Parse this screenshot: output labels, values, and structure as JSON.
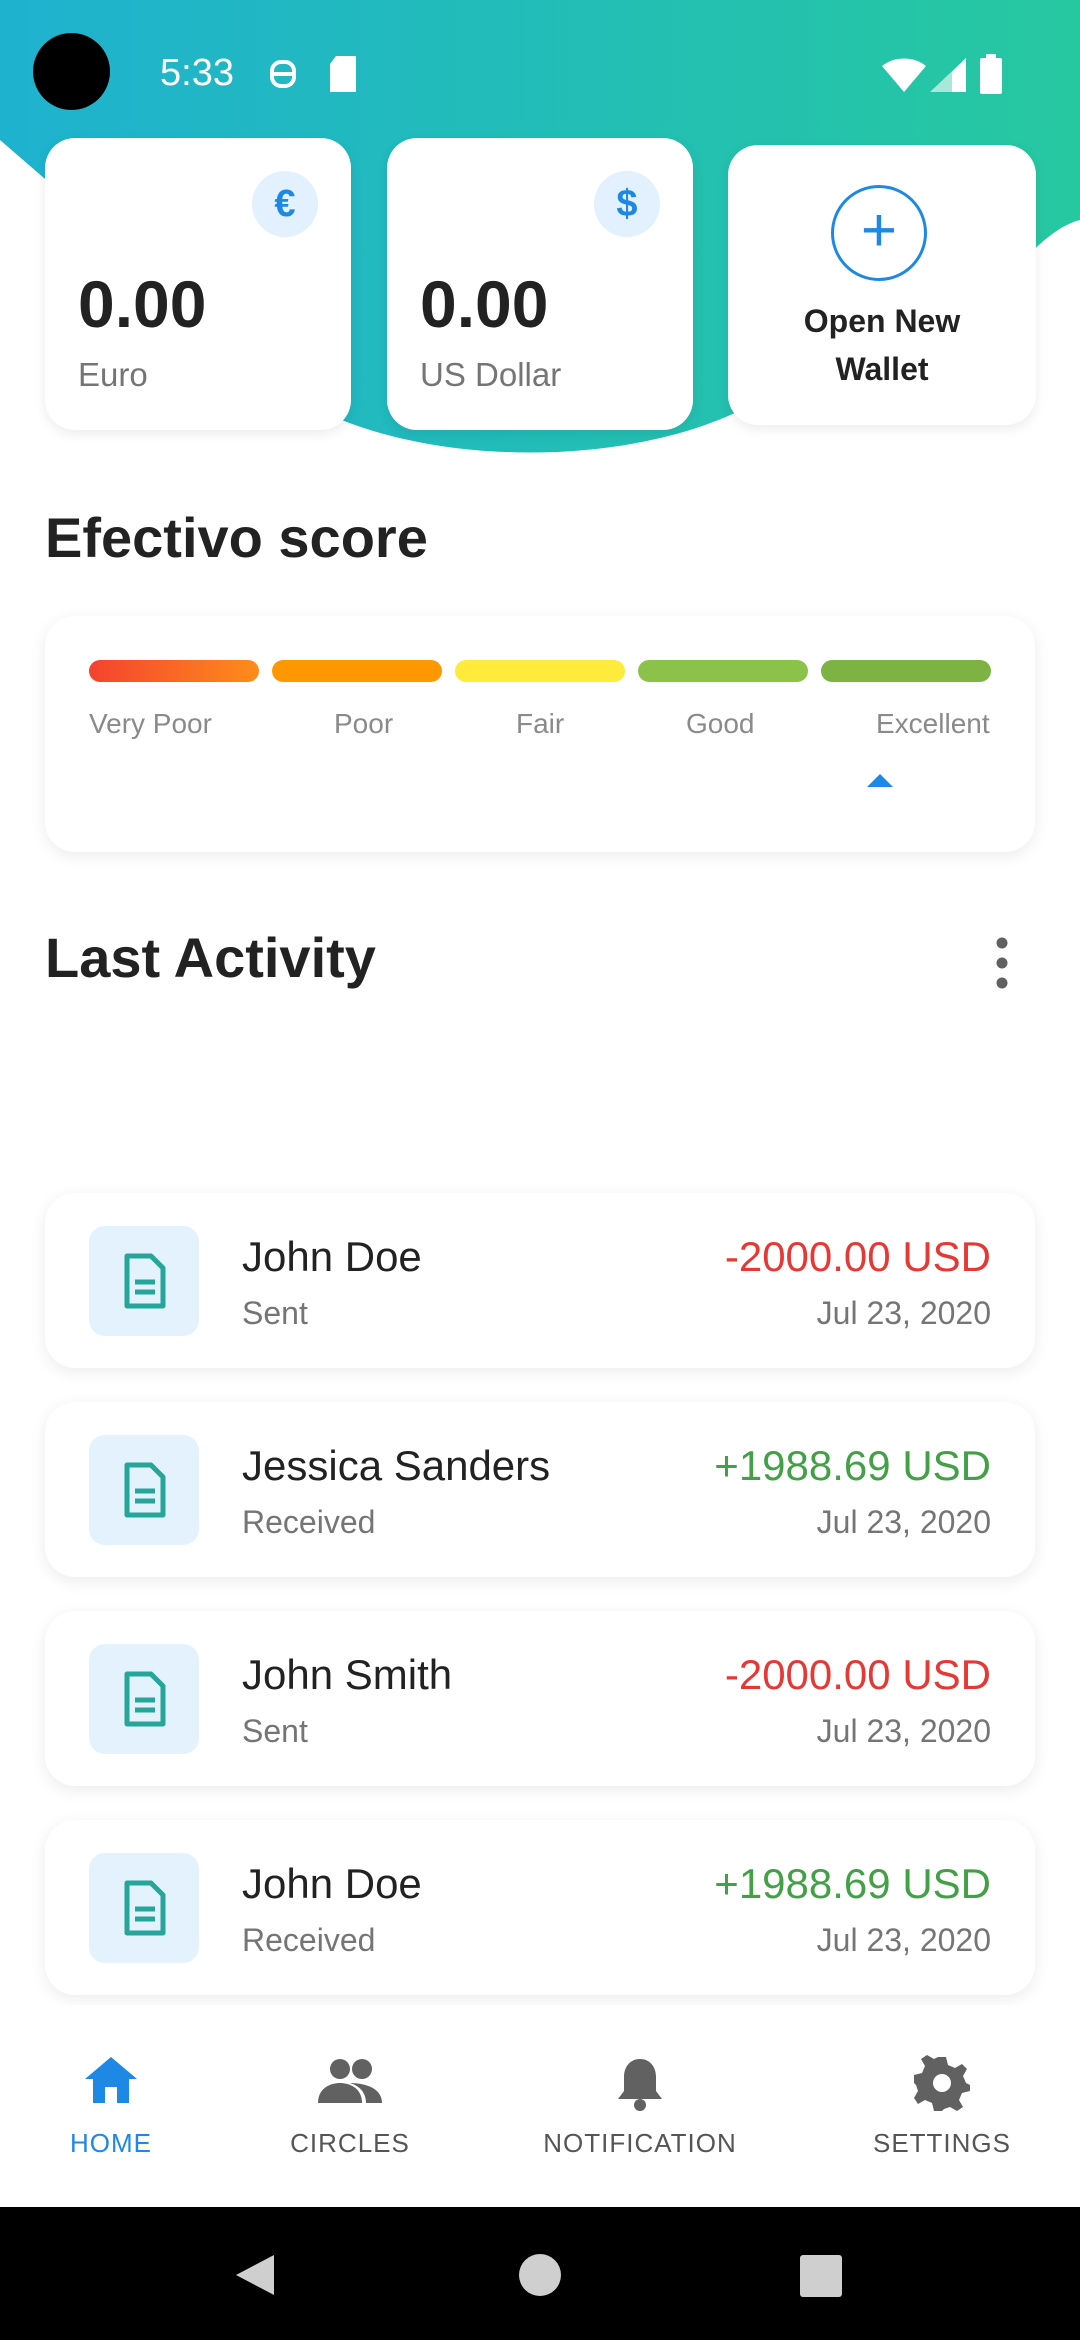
{
  "status_bar": {
    "time": "5:33"
  },
  "wallets": [
    {
      "amount": "0.00",
      "currency": "Euro",
      "symbol": "€"
    },
    {
      "amount": "0.00",
      "currency": "US Dollar",
      "symbol": "$"
    }
  ],
  "open_wallet": {
    "line1": "Open New",
    "line2": "Wallet"
  },
  "score": {
    "title": "Efectivo score",
    "levels": [
      {
        "label": "Very Poor",
        "color": "#f4511e"
      },
      {
        "label": "Poor",
        "color": "#ff9800"
      },
      {
        "label": "Fair",
        "color": "#ffeb3b"
      },
      {
        "label": "Good",
        "color": "#8bc34a"
      },
      {
        "label": "Excellent",
        "color": "#7cb342"
      }
    ],
    "current_level": "Excellent"
  },
  "activity": {
    "title": "Last Activity",
    "items": [
      {
        "name": "John Doe",
        "type": "Sent",
        "amount": "-2000.00 USD",
        "date": "Jul 23, 2020",
        "direction": "out"
      },
      {
        "name": "Jessica Sanders",
        "type": "Received",
        "amount": "+1988.69 USD",
        "date": "Jul 23, 2020",
        "direction": "in"
      },
      {
        "name": "John Smith",
        "type": "Sent",
        "amount": "-2000.00 USD",
        "date": "Jul 23, 2020",
        "direction": "out"
      },
      {
        "name": "John Doe",
        "type": "Received",
        "amount": "+1988.69 USD",
        "date": "Jul 23, 2020",
        "direction": "in"
      }
    ]
  },
  "nav": {
    "items": [
      {
        "label": "HOME",
        "icon": "home-icon",
        "active": true
      },
      {
        "label": "CIRCLES",
        "icon": "people-icon",
        "active": false
      },
      {
        "label": "NOTIFICATION",
        "icon": "bell-icon",
        "active": false
      },
      {
        "label": "SETTINGS",
        "icon": "gear-icon",
        "active": false
      }
    ]
  },
  "colors": {
    "accent": "#1e88e5",
    "gradient_start": "#1fb2cf",
    "gradient_end": "#26c5a0",
    "negative": "#e53935",
    "positive": "#43a047"
  }
}
